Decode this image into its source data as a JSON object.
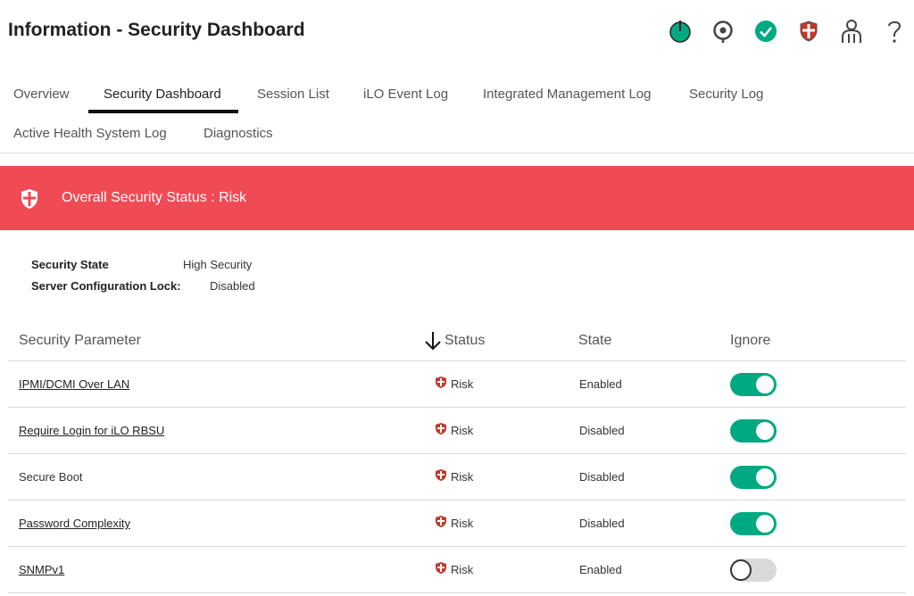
{
  "page_title": "Information - Security Dashboard",
  "header_icons": [
    "power-icon",
    "health-target-icon",
    "status-ok-icon",
    "security-shield-icon",
    "user-icon",
    "help-icon"
  ],
  "tabs_row1": [
    {
      "label": "Overview",
      "active": false
    },
    {
      "label": "Security Dashboard",
      "active": true
    },
    {
      "label": "Session List",
      "active": false
    },
    {
      "label": "iLO Event Log",
      "active": false
    },
    {
      "label": "Integrated Management Log",
      "active": false
    },
    {
      "label": "Security Log",
      "active": false
    }
  ],
  "tabs_row2": [
    {
      "label": "Active Health System Log",
      "active": false
    },
    {
      "label": "Diagnostics",
      "active": false
    }
  ],
  "banner": {
    "text": "Overall Security Status : Risk",
    "color": "#f04a55"
  },
  "info": {
    "security_state_label": "Security State",
    "security_state_value": "High Security",
    "config_lock_label": "Server Configuration Lock:",
    "config_lock_value": "Disabled"
  },
  "table": {
    "headers": {
      "parameter": "Security Parameter",
      "status": "Status",
      "state": "State",
      "ignore": "Ignore"
    },
    "sort_column": "status",
    "rows": [
      {
        "parameter": "IPMI/DCMI Over LAN",
        "link": true,
        "status": "Risk",
        "state": "Enabled",
        "ignore": true
      },
      {
        "parameter": "Require Login for iLO RBSU",
        "link": true,
        "status": "Risk",
        "state": "Disabled",
        "ignore": true
      },
      {
        "parameter": "Secure Boot",
        "link": false,
        "status": "Risk",
        "state": "Disabled",
        "ignore": true
      },
      {
        "parameter": "Password Complexity",
        "link": true,
        "status": "Risk",
        "state": "Disabled",
        "ignore": true
      },
      {
        "parameter": "SNMPv1",
        "link": true,
        "status": "Risk",
        "state": "Enabled",
        "ignore": false
      }
    ]
  },
  "colors": {
    "accent_green": "#01a982",
    "risk_red": "#f04a55",
    "shield_dark_red": "#c0392b"
  }
}
